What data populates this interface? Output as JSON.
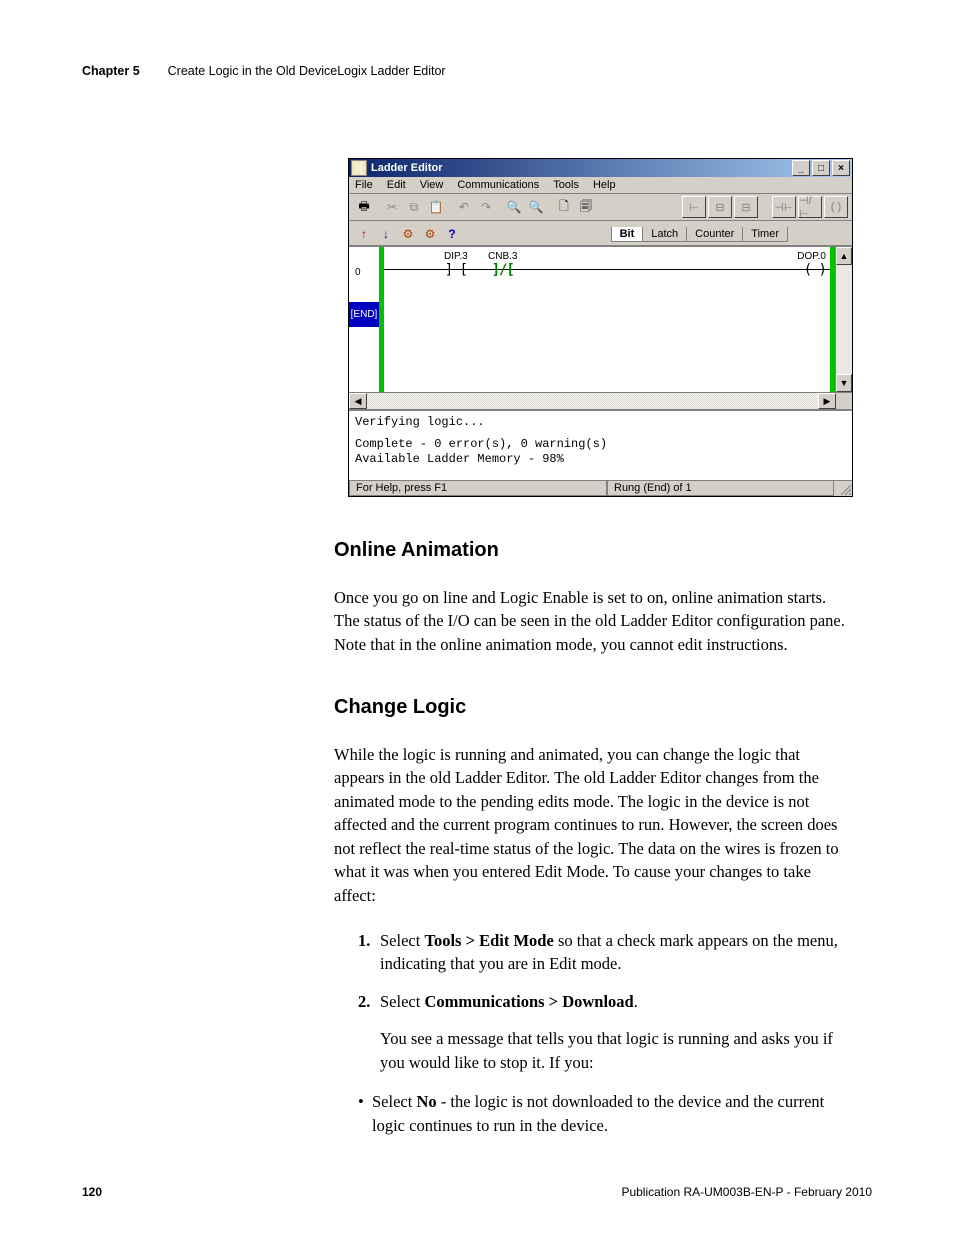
{
  "header": {
    "chapter": "Chapter 5",
    "title": "Create Logic in the Old DeviceLogix Ladder Editor"
  },
  "screenshot": {
    "window_title": "Ladder Editor",
    "menu": [
      "File",
      "Edit",
      "View",
      "Communications",
      "Tools",
      "Help"
    ],
    "tabs": [
      "Bit",
      "Latch",
      "Counter",
      "Timer"
    ],
    "rung0_label": "0",
    "end_label": "[END]",
    "elems": {
      "dip": "DIP.3",
      "cnb": "CNB.3",
      "dop": "DOP.0"
    },
    "output": {
      "line1": "Verifying logic...",
      "line2": "Complete - 0 error(s), 0 warning(s)",
      "line3": "Available Ladder Memory - 98%"
    },
    "status_left": "For Help, press F1",
    "status_right": "Rung (End) of 1"
  },
  "sections": {
    "s1_title": "Online Animation",
    "s1_para": "Once you go on line and Logic Enable is set to on, online animation starts. The status of the I/O can be seen in the old Ladder Editor configuration pane. Note that in the online animation mode, you cannot edit instructions.",
    "s2_title": "Change Logic",
    "s2_para": "While the logic is running and animated, you can change the logic that appears in the old Ladder Editor. The old Ladder Editor changes from the animated mode to the pending edits mode. The logic in the device is not affected and the current program continues to run. However, the screen does not reflect the real-time status of the logic. The data on the wires is frozen to what it was when you entered Edit Mode. To cause your changes to take affect:",
    "step1_num": "1.",
    "step1_a": "Select ",
    "step1_b": "Tools > Edit Mode",
    "step1_c": " so that a check mark appears on the menu, indicating that you are in Edit mode.",
    "step2_num": "2.",
    "step2_a": "Select ",
    "step2_b": "Communications > Download",
    "step2_c": ".",
    "step2_sub": "You see a message that tells you that logic is running and asks you if you would like to stop it. If you:",
    "bullet_dot": "•",
    "bullet_a": "Select ",
    "bullet_b": "No",
    "bullet_c": " - the logic is not downloaded to the device and the current logic continues to run in the device."
  },
  "footer": {
    "page": "120",
    "pub": "Publication RA-UM003B-EN-P - February 2010"
  }
}
